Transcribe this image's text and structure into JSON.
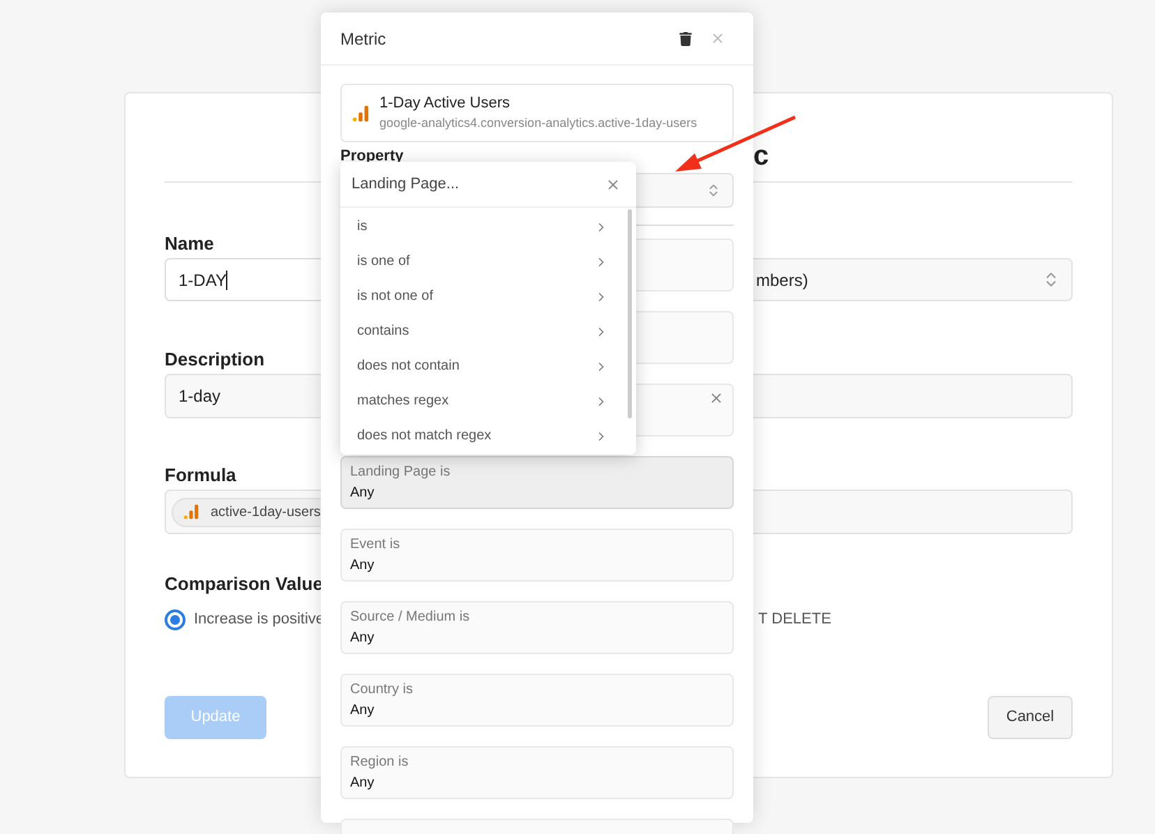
{
  "page": {
    "heading_fragment": "c",
    "name_field": {
      "label": "Name",
      "value": "1-DAY"
    },
    "format_select": {
      "value": "mbers)"
    },
    "description_field": {
      "label": "Description",
      "value": "1-day"
    },
    "formula_field": {
      "label": "Formula",
      "chip": "active-1day-users"
    },
    "comparison": {
      "label": "Comparison Value",
      "options": [
        {
          "label": "Increase is positive",
          "selected": true
        }
      ],
      "right_text": "T DELETE"
    },
    "update_button": {
      "label": "Update",
      "disabled": true
    },
    "cancel_button": {
      "label": "Cancel"
    }
  },
  "modal": {
    "title": "Metric",
    "metric": {
      "name": "1-Day Active Users",
      "path": "google-analytics4.conversion-analytics.active-1day-users"
    },
    "property": {
      "label": "Property"
    },
    "filters": [
      {
        "kind": "blank",
        "selected": false
      },
      {
        "kind": "blank",
        "selected": false
      },
      {
        "kind": "clearable",
        "selected": false
      },
      {
        "kind": "field",
        "label": "Landing Page is",
        "value": "Any",
        "selected": true
      },
      {
        "kind": "field",
        "label": "Event is",
        "value": "Any",
        "selected": false
      },
      {
        "kind": "field",
        "label": "Source / Medium is",
        "value": "Any",
        "selected": false
      },
      {
        "kind": "field",
        "label": "Country is",
        "value": "Any",
        "selected": false
      },
      {
        "kind": "field",
        "label": "Region is",
        "value": "Any",
        "selected": false
      },
      {
        "kind": "blank",
        "selected": false
      }
    ]
  },
  "popover": {
    "title": "Landing Page...",
    "items": [
      {
        "label": "is"
      },
      {
        "label": "is one of"
      },
      {
        "label": "is not one of"
      },
      {
        "label": "contains"
      },
      {
        "label": "does not contain"
      },
      {
        "label": "matches regex"
      },
      {
        "label": "does not match regex"
      }
    ]
  }
}
